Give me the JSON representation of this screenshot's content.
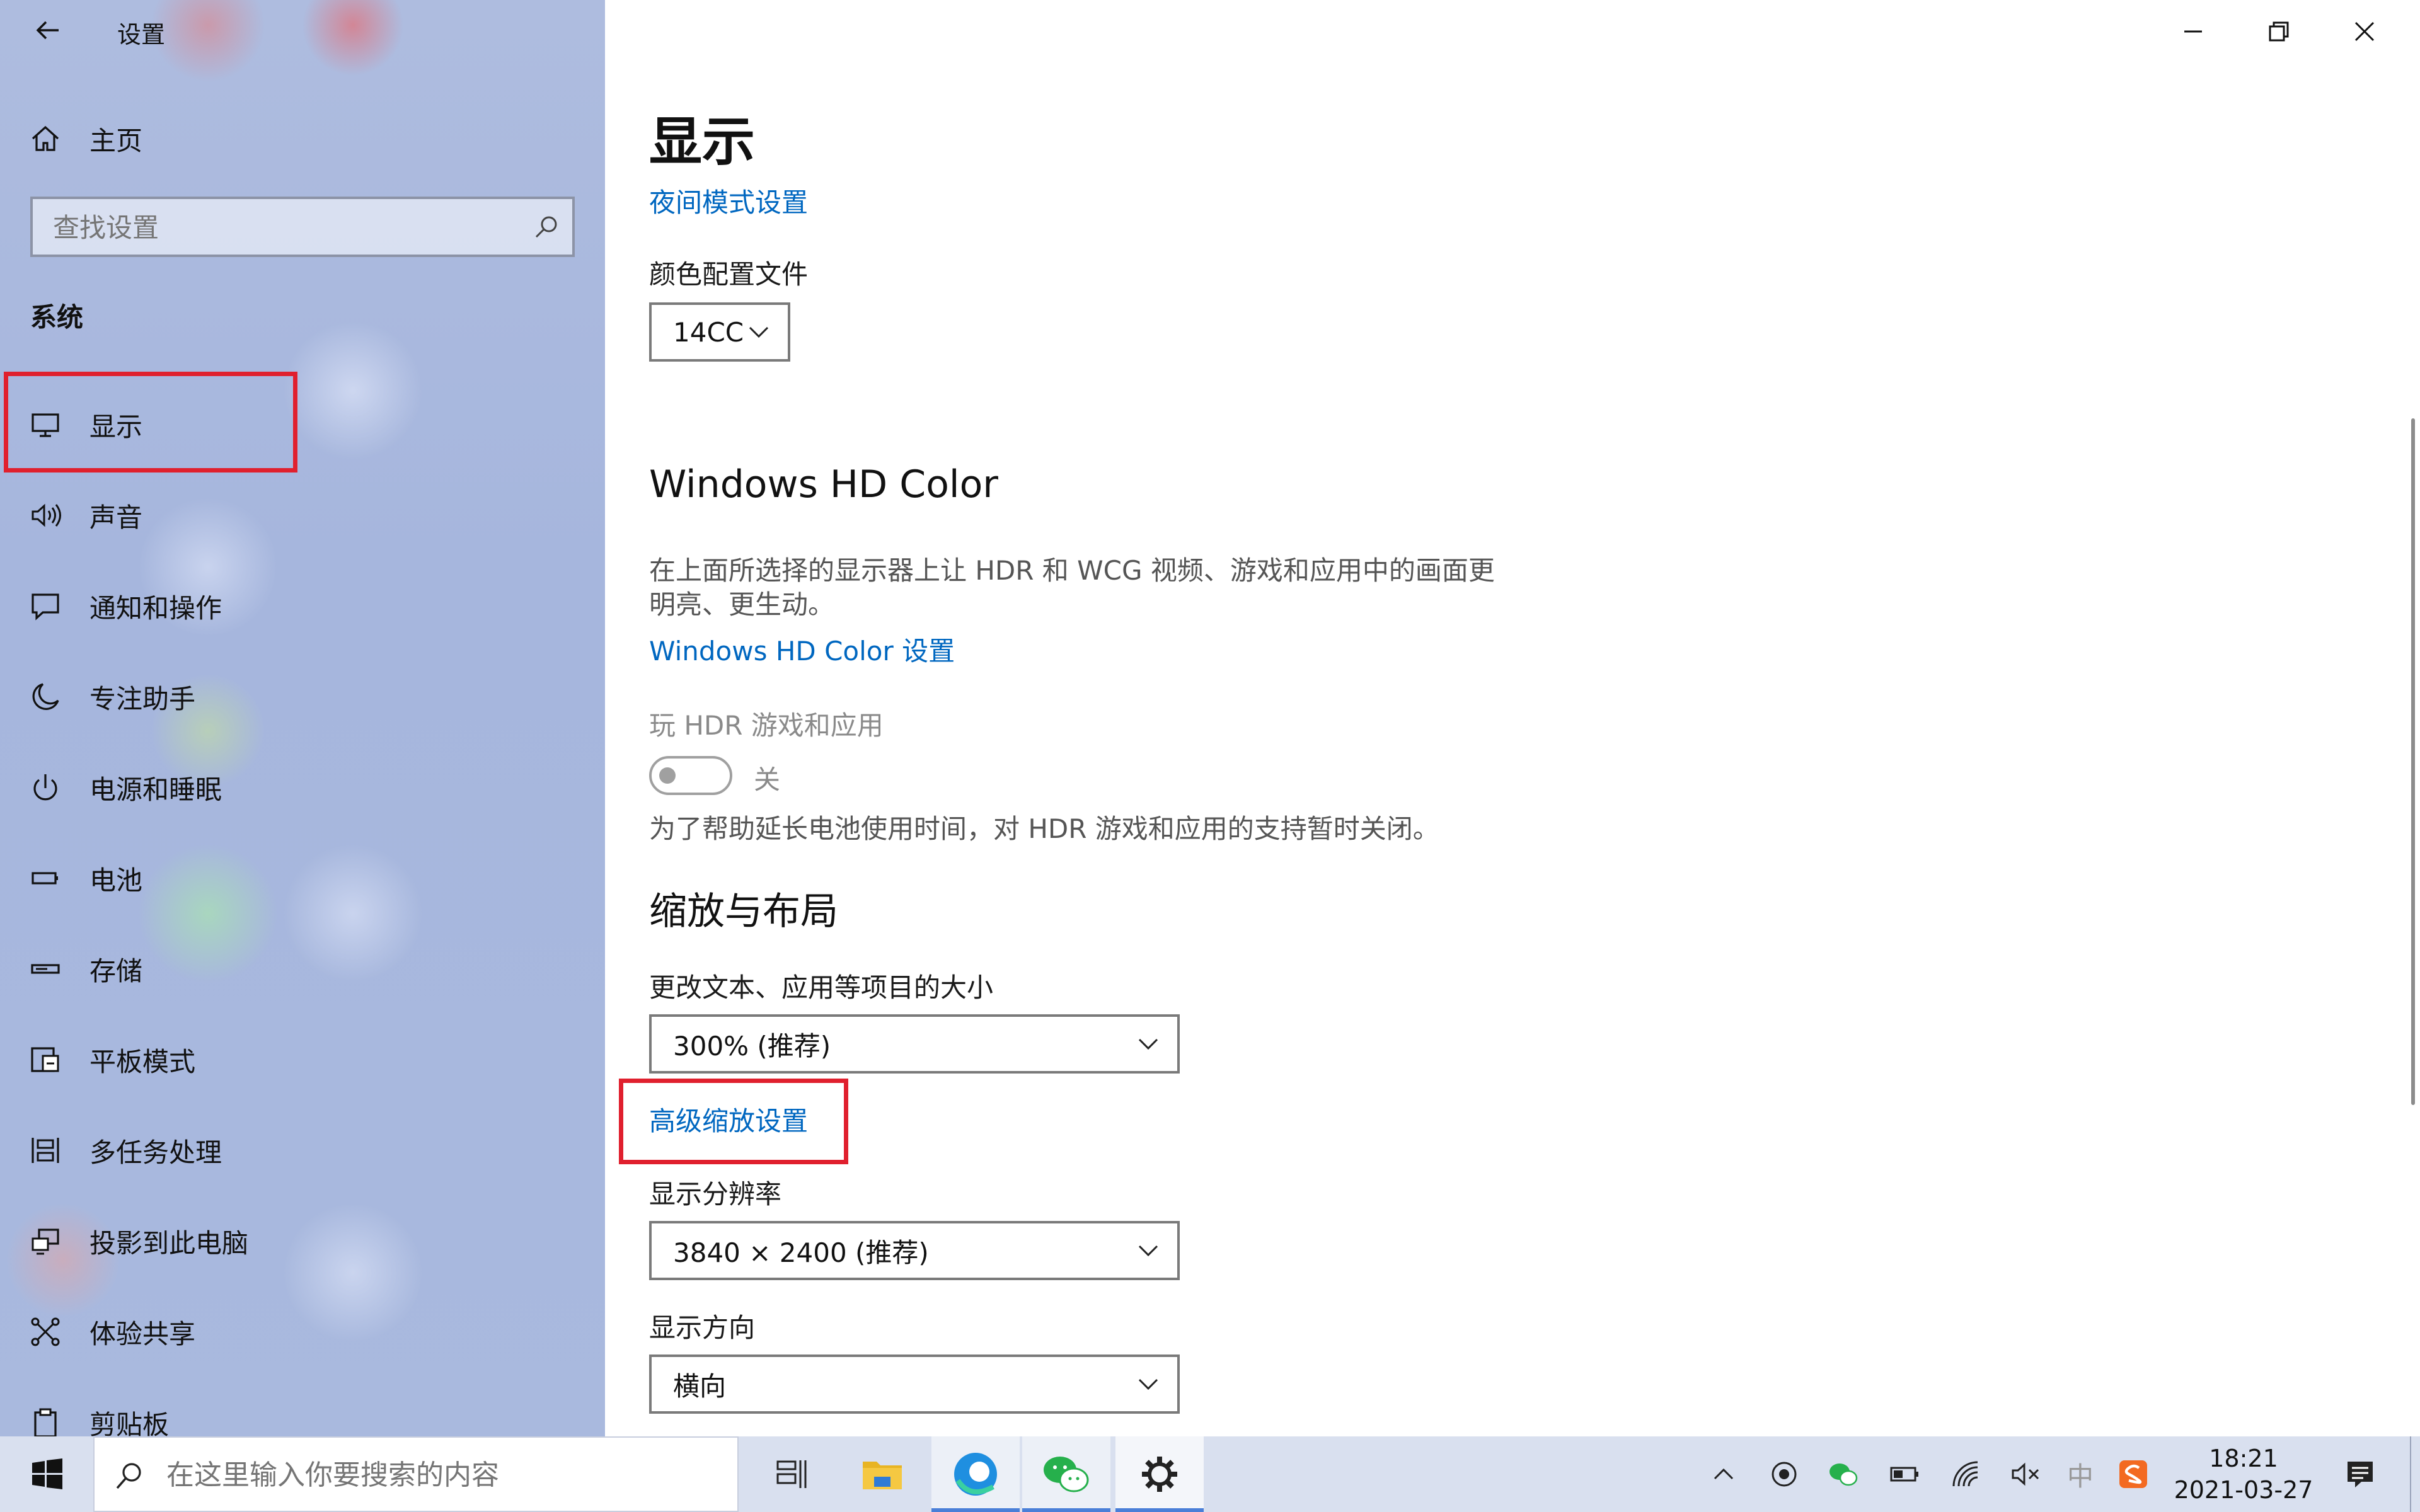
{
  "window": {
    "title": "设置",
    "controls": {
      "minimize": "minimize-icon",
      "restore": "restore-icon",
      "close": "close-icon"
    }
  },
  "sidebar": {
    "home_label": "主页",
    "search_placeholder": "查找设置",
    "section": "系统",
    "items": [
      {
        "label": "显示",
        "icon": "monitor-icon"
      },
      {
        "label": "声音",
        "icon": "speaker-icon"
      },
      {
        "label": "通知和操作",
        "icon": "notification-icon"
      },
      {
        "label": "专注助手",
        "icon": "moon-icon"
      },
      {
        "label": "电源和睡眠",
        "icon": "power-icon"
      },
      {
        "label": "电池",
        "icon": "battery-icon"
      },
      {
        "label": "存储",
        "icon": "storage-icon"
      },
      {
        "label": "平板模式",
        "icon": "tablet-icon"
      },
      {
        "label": "多任务处理",
        "icon": "multitask-icon"
      },
      {
        "label": "投影到此电脑",
        "icon": "project-icon"
      },
      {
        "label": "体验共享",
        "icon": "share-icon"
      },
      {
        "label": "剪贴板",
        "icon": "clipboard-icon"
      }
    ]
  },
  "main": {
    "page_title": "显示",
    "night_light_link": "夜间模式设置",
    "color_profile_label": "颜色配置文件",
    "color_profile_value": "14CC",
    "hdr_heading": "Windows HD Color",
    "hdr_desc_line1": "在上面所选择的显示器上让 HDR 和 WCG 视频、游戏和应用中的画面更",
    "hdr_desc_line2": "明亮、更生动。",
    "hdr_settings_link": "Windows HD Color 设置",
    "hdr_games_label": "玩 HDR 游戏和应用",
    "toggle_state": "关",
    "battery_note": "为了帮助延长电池使用时间，对 HDR 游戏和应用的支持暂时关闭。",
    "scale_heading": "缩放与布局",
    "scale_label": "更改文本、应用等项目的大小",
    "scale_value": "300% (推荐)",
    "advanced_scaling_link": "高级缩放设置",
    "resolution_label": "显示分辨率",
    "resolution_value": "3840 × 2400 (推荐)",
    "orientation_label": "显示方向",
    "orientation_value": "横向"
  },
  "taskbar": {
    "search_placeholder": "在这里输入你要搜索的内容",
    "time": "18:21",
    "date": "2021-03-27",
    "ime": "中",
    "apps": [
      "task-view-icon",
      "file-explorer-icon",
      "edge-icon",
      "wechat-icon",
      "settings-icon"
    ]
  },
  "colors": {
    "accent": "#0067c0",
    "highlight_box": "#e0202e",
    "taskbar": "#d9e0ef"
  }
}
